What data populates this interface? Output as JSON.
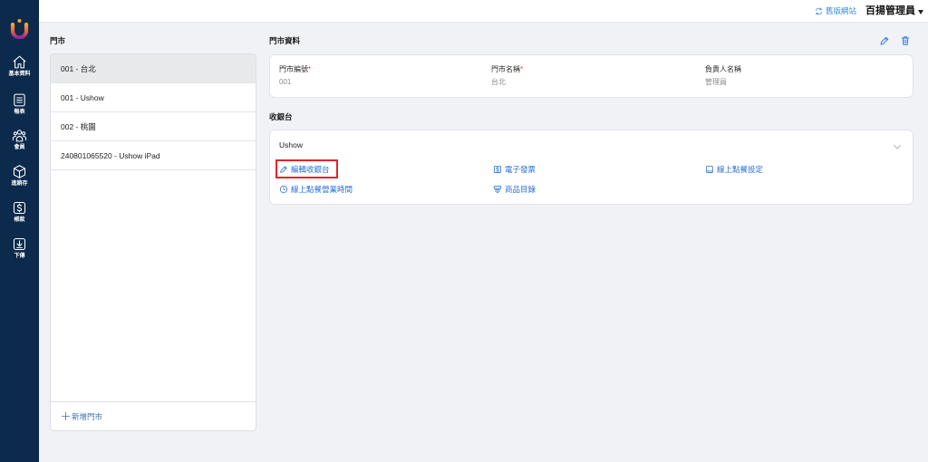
{
  "sidebar": {
    "logo_icon": "brand-logo",
    "items": [
      {
        "label": "基本資料",
        "icon": "home-icon"
      },
      {
        "label": "報表",
        "icon": "report-icon"
      },
      {
        "label": "會員",
        "icon": "members-icon"
      },
      {
        "label": "進銷存",
        "icon": "inventory-cube-icon"
      },
      {
        "label": "帳款",
        "icon": "dollar-icon"
      },
      {
        "label": "下傳",
        "icon": "download-icon"
      }
    ]
  },
  "header": {
    "legacy_link_label": "舊版網站",
    "legacy_link_icon": "refresh-icon",
    "user_name": "百揚管理員"
  },
  "stores": {
    "title": "門市",
    "items": [
      {
        "label": "001 - 台北",
        "selected": true
      },
      {
        "label": "001 - Ushow",
        "selected": false
      },
      {
        "label": "002 - 桃園",
        "selected": false
      },
      {
        "label": "240801065520 - Ushow iPad",
        "selected": false
      }
    ],
    "add_label": "新增門市"
  },
  "store_info": {
    "title": "門市資料",
    "required_mark": "*",
    "fields": [
      {
        "label": "門市編號",
        "required": true,
        "value": "001"
      },
      {
        "label": "門市名稱",
        "required": true,
        "value": "台北"
      },
      {
        "label": "負責人名稱",
        "required": false,
        "value": "管理員"
      }
    ]
  },
  "registers": {
    "title": "收銀台",
    "items": [
      {
        "name": "Ushow",
        "expanded": true,
        "actions": [
          {
            "label": "編輯收銀台",
            "icon": "pencil-icon",
            "highlighted": true
          },
          {
            "label": "電子發票",
            "icon": "invoice-icon"
          },
          {
            "label": "線上點餐設定",
            "icon": "tablet-icon"
          },
          {
            "label": "線上點餐營業時間",
            "icon": "clock-icon"
          },
          {
            "label": "商品目錄",
            "icon": "catalog-icon"
          }
        ]
      }
    ]
  },
  "theme": {
    "sidebar": "#0b2a4c",
    "accent": "#2a6fd6",
    "required": "#e53935",
    "highlight_outline": "#e0262b",
    "background": "#f0f2f5"
  }
}
